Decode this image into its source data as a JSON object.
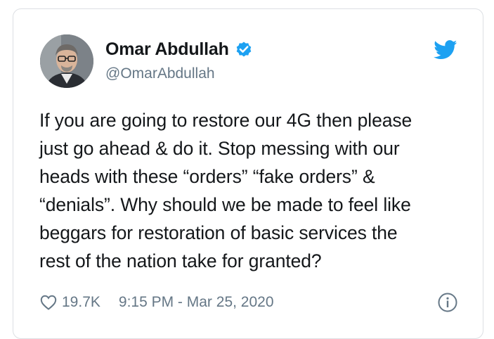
{
  "tweet": {
    "display_name": "Omar Abdullah",
    "handle": "@OmarAbdullah",
    "verified": true,
    "text": "If you are going to restore our 4G then please\njust go ahead & do it. Stop messing with our\nheads with these “orders” “fake orders” &\n“denials”. Why should we be made to feel like\nbeggars for restoration of basic services the\nrest of the nation take for granted?",
    "likes": "19.7K",
    "timestamp": "9:15 PM - Mar 25, 2020"
  },
  "icons": {
    "like": "heart-outline-icon",
    "info": "info-circle-icon",
    "brand": "twitter-bird-icon",
    "verified": "verified-badge-icon"
  },
  "colors": {
    "twitter_blue": "#1da1f2",
    "text": "#14171a",
    "secondary_text": "#657786",
    "border": "#dcdfe3"
  }
}
